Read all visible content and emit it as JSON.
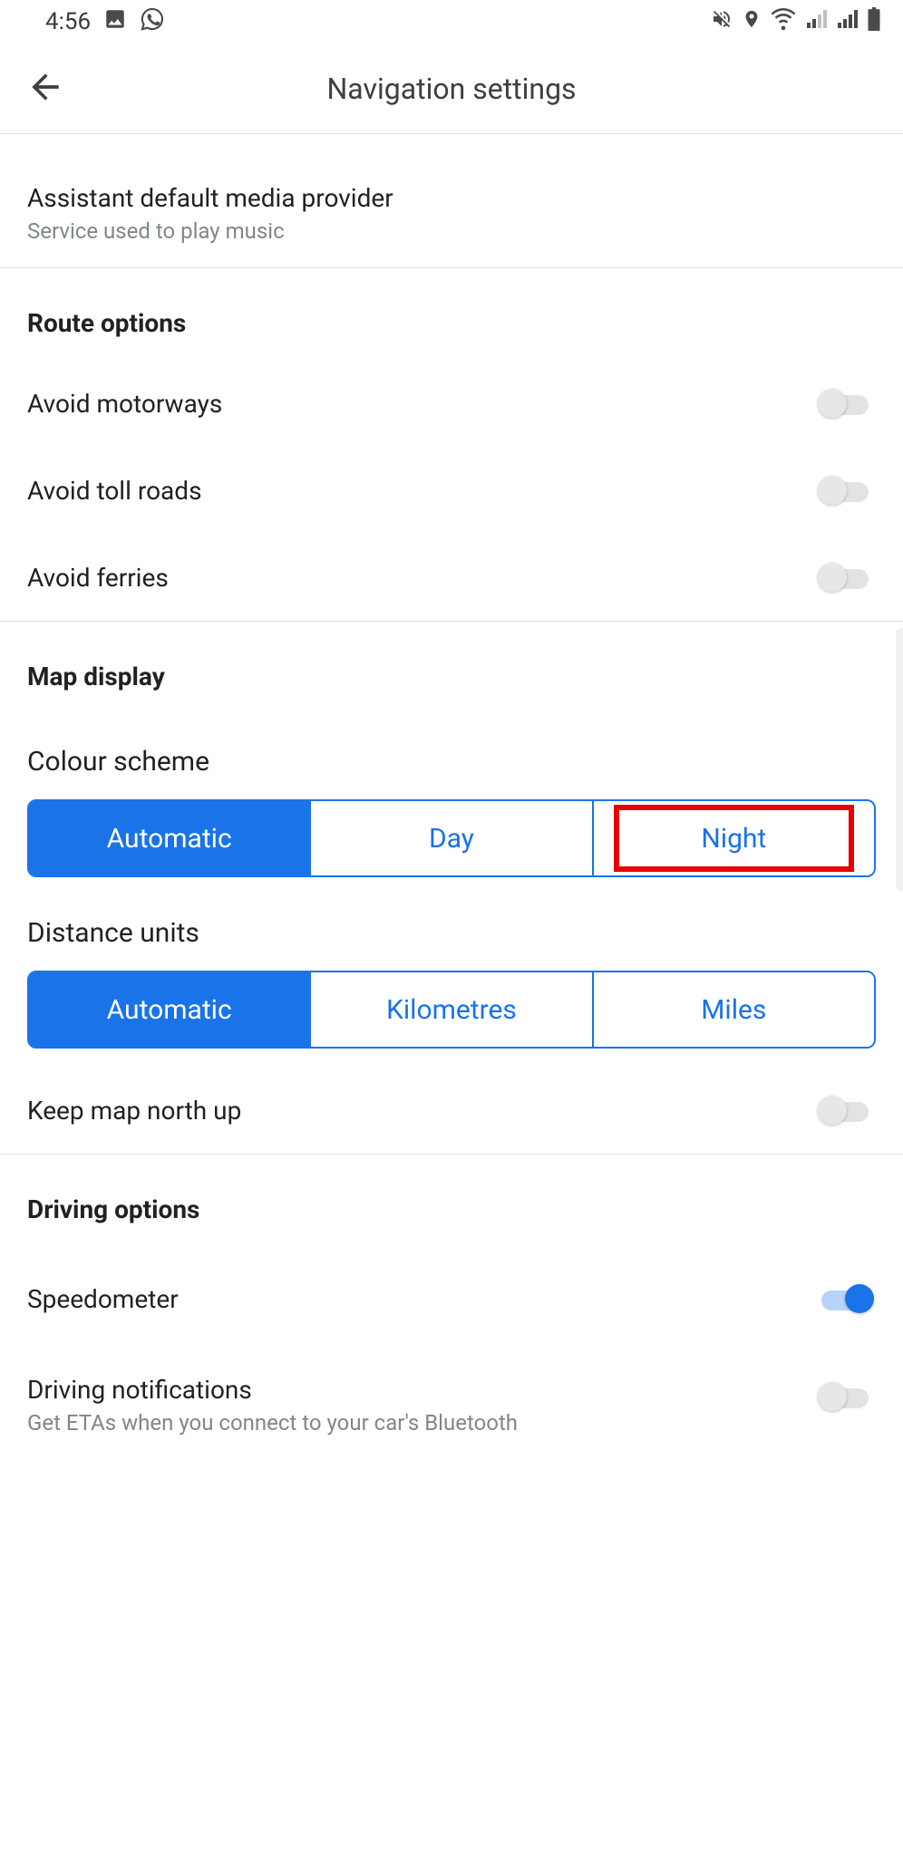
{
  "status": {
    "time": "4:56"
  },
  "appbar": {
    "title": "Navigation settings"
  },
  "media": {
    "title": "Assistant default media provider",
    "subtitle": "Service used to play music"
  },
  "route": {
    "header": "Route options",
    "avoid_motorways": "Avoid motorways",
    "avoid_toll_roads": "Avoid toll roads",
    "avoid_ferries": "Avoid ferries"
  },
  "map": {
    "header": "Map display",
    "colour_scheme_label": "Colour scheme",
    "colour_scheme": {
      "automatic": "Automatic",
      "day": "Day",
      "night": "Night"
    },
    "distance_units_label": "Distance units",
    "distance_units": {
      "automatic": "Automatic",
      "kilometres": "Kilometres",
      "miles": "Miles"
    },
    "keep_north": "Keep map north up"
  },
  "driving": {
    "header": "Driving options",
    "speedometer": "Speedometer",
    "notifications_title": "Driving notifications",
    "notifications_subtitle": "Get ETAs when you connect to your car's Bluetooth"
  }
}
